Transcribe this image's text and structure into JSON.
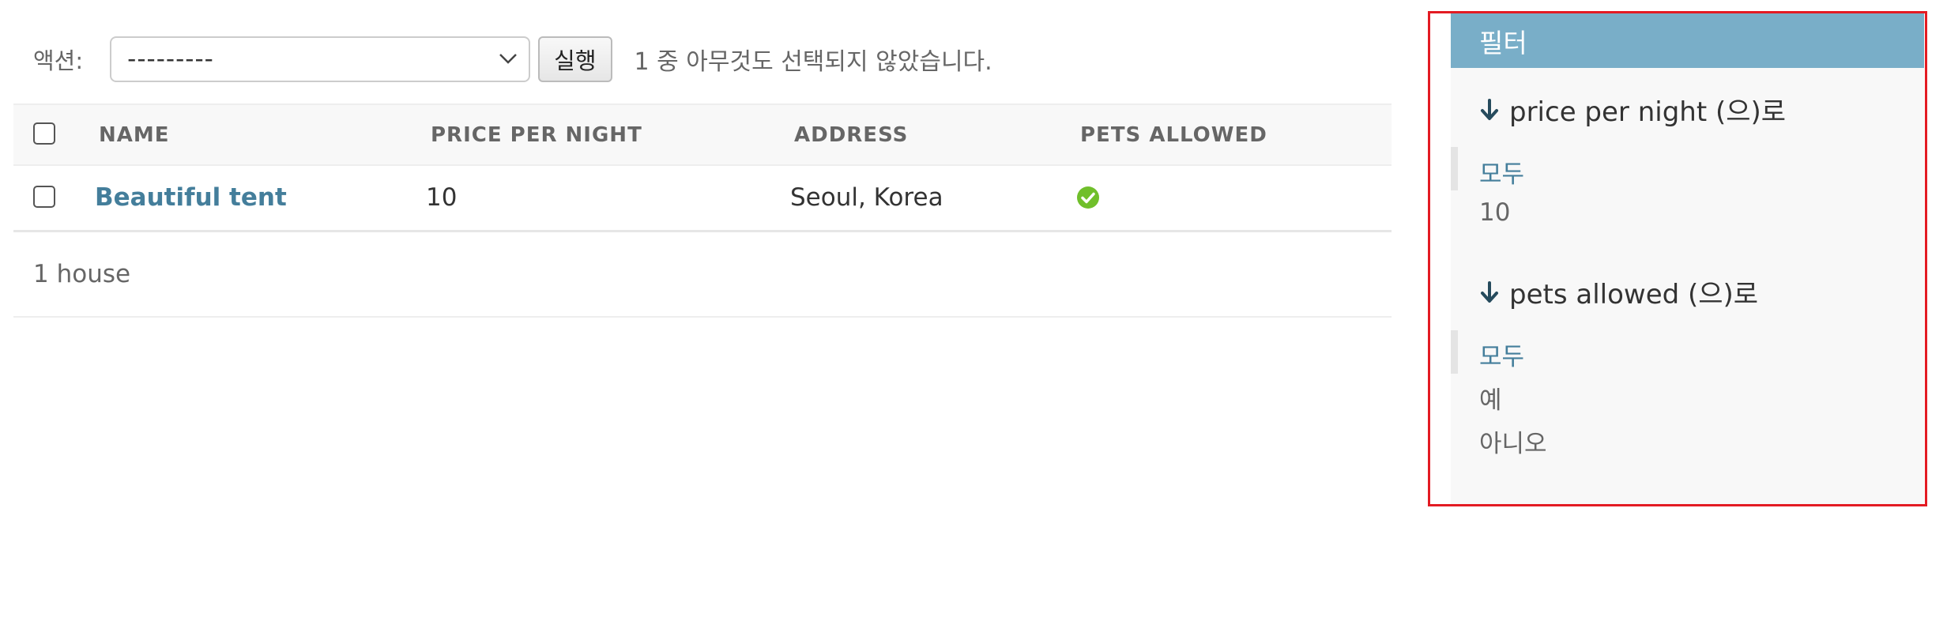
{
  "actions": {
    "label": "액션:",
    "select_value": "---------",
    "go_label": "실행",
    "counter": "1 중 아무것도 선택되지 않았습니다."
  },
  "table": {
    "columns": [
      "NAME",
      "PRICE PER NIGHT",
      "ADDRESS",
      "PETS ALLOWED"
    ],
    "rows": [
      {
        "name": "Beautiful tent",
        "price_per_night": "10",
        "address": "Seoul, Korea",
        "pets_allowed_icon": "check-circle-icon"
      }
    ]
  },
  "paginator": {
    "text": "1 house"
  },
  "filter": {
    "header": "필터",
    "groups": [
      {
        "title": "price per night (으)로",
        "options": [
          {
            "label": "모두",
            "selected": true
          },
          {
            "label": "10",
            "selected": false
          }
        ]
      },
      {
        "title": "pets allowed (으)로",
        "options": [
          {
            "label": "모두",
            "selected": true
          },
          {
            "label": "예",
            "selected": false
          },
          {
            "label": "아니오",
            "selected": false
          }
        ]
      }
    ]
  },
  "colors": {
    "filter_header_bg": "#79aec8",
    "link": "#447e9b",
    "highlight_border": "#e31b23",
    "success_green": "#70bf2b"
  }
}
